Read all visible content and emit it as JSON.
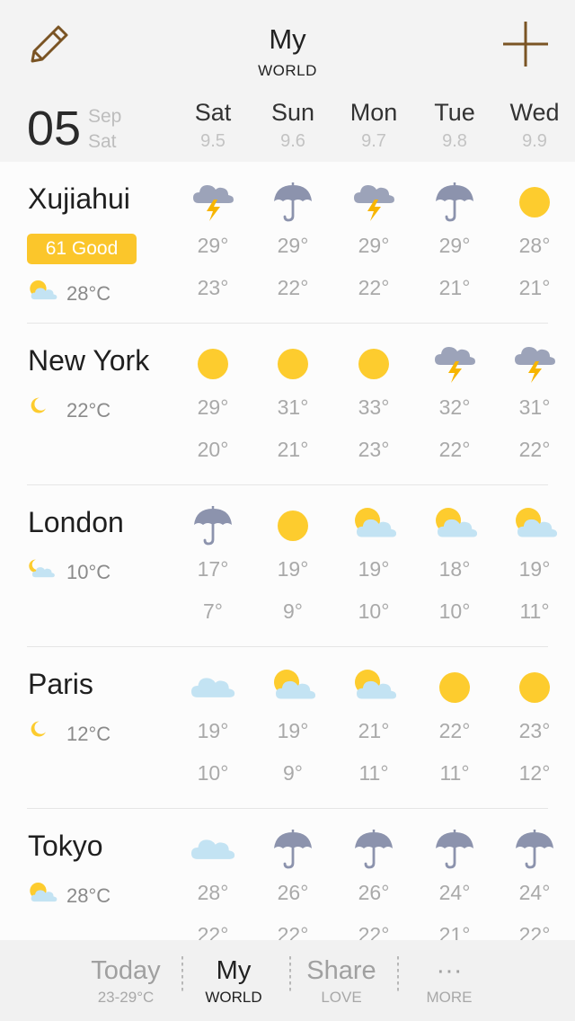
{
  "header": {
    "title": "My",
    "subtitle": "WORLD",
    "edit_icon": "pencil-icon",
    "add_icon": "plus-icon",
    "accent_color": "#7a5424"
  },
  "date": {
    "day": "05",
    "month": "Sep",
    "weekday": "Sat"
  },
  "days": [
    {
      "name": "Sat",
      "date": "9.5"
    },
    {
      "name": "Sun",
      "date": "9.6"
    },
    {
      "name": "Mon",
      "date": "9.7"
    },
    {
      "name": "Tue",
      "date": "9.8"
    },
    {
      "name": "Wed",
      "date": "9.9"
    }
  ],
  "cities": [
    {
      "name": "Xujiahui",
      "aqi": "61 Good",
      "current_icon": "partly-cloudy",
      "current_temp": "28°C",
      "forecast": [
        {
          "icon": "thunderstorm",
          "high": "29°",
          "low": "23°"
        },
        {
          "icon": "rain",
          "high": "29°",
          "low": "22°"
        },
        {
          "icon": "thunderstorm",
          "high": "29°",
          "low": "22°"
        },
        {
          "icon": "rain",
          "high": "29°",
          "low": "21°"
        },
        {
          "icon": "sunny",
          "high": "28°",
          "low": "21°"
        }
      ]
    },
    {
      "name": "New York",
      "current_icon": "moon",
      "current_temp": "22°C",
      "forecast": [
        {
          "icon": "sunny",
          "high": "29°",
          "low": "20°"
        },
        {
          "icon": "sunny",
          "high": "31°",
          "low": "21°"
        },
        {
          "icon": "sunny",
          "high": "33°",
          "low": "23°"
        },
        {
          "icon": "thunderstorm",
          "high": "32°",
          "low": "22°"
        },
        {
          "icon": "thunderstorm",
          "high": "31°",
          "low": "22°"
        }
      ]
    },
    {
      "name": "London",
      "current_icon": "night-cloudy",
      "current_temp": "10°C",
      "forecast": [
        {
          "icon": "rain",
          "high": "17°",
          "low": "7°"
        },
        {
          "icon": "sunny",
          "high": "19°",
          "low": "9°"
        },
        {
          "icon": "partly-cloudy",
          "high": "19°",
          "low": "10°"
        },
        {
          "icon": "partly-cloudy",
          "high": "18°",
          "low": "10°"
        },
        {
          "icon": "partly-cloudy",
          "high": "19°",
          "low": "11°"
        }
      ]
    },
    {
      "name": "Paris",
      "current_icon": "moon",
      "current_temp": "12°C",
      "forecast": [
        {
          "icon": "cloudy",
          "high": "19°",
          "low": "10°"
        },
        {
          "icon": "partly-cloudy",
          "high": "19°",
          "low": "9°"
        },
        {
          "icon": "partly-cloudy",
          "high": "21°",
          "low": "11°"
        },
        {
          "icon": "sunny",
          "high": "22°",
          "low": "11°"
        },
        {
          "icon": "sunny",
          "high": "23°",
          "low": "12°"
        }
      ]
    },
    {
      "name": "Tokyo",
      "current_icon": "partly-cloudy",
      "current_temp": "28°C",
      "forecast": [
        {
          "icon": "cloudy",
          "high": "28°",
          "low": "22°"
        },
        {
          "icon": "rain",
          "high": "26°",
          "low": "22°"
        },
        {
          "icon": "rain",
          "high": "26°",
          "low": "22°"
        },
        {
          "icon": "rain",
          "high": "24°",
          "low": "21°"
        },
        {
          "icon": "rain",
          "high": "24°",
          "low": "22°"
        }
      ]
    }
  ],
  "tabs": [
    {
      "main": "Today",
      "sub": "23-29°C",
      "active": false
    },
    {
      "main": "My",
      "sub": "WORLD",
      "active": true
    },
    {
      "main": "Share",
      "sub": "LOVE",
      "active": false
    },
    {
      "main": "···",
      "sub": "MORE",
      "active": false
    }
  ],
  "colors": {
    "aqi_badge": "#fbc62b",
    "sun": "#fdcc2e",
    "cloud": "#c3e3f3",
    "rain_cloud": "#8c93ad",
    "lightning": "#f7b500"
  }
}
